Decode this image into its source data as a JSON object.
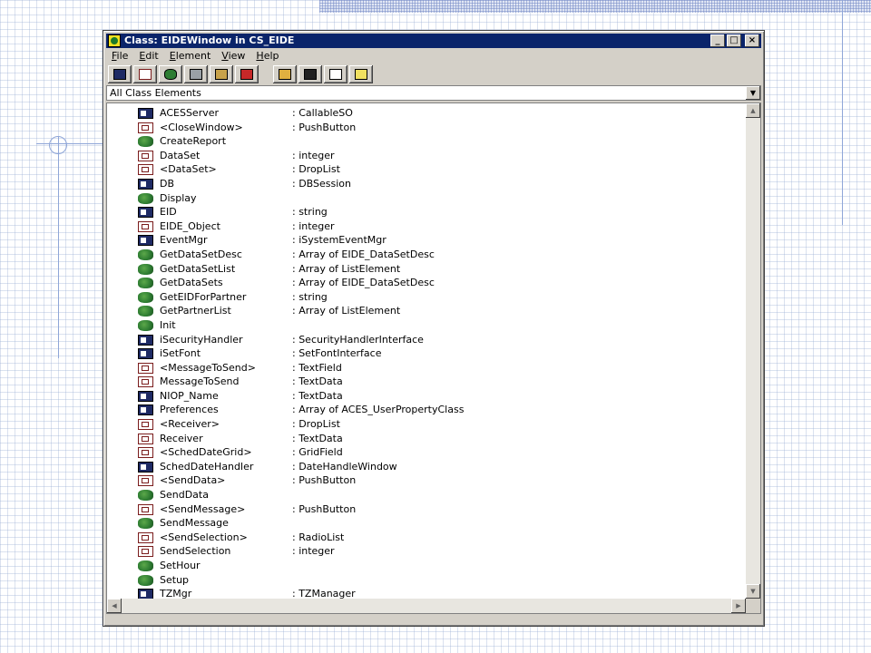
{
  "window": {
    "title": "Class: EIDEWindow in CS_EIDE",
    "controls": {
      "minimize": "_",
      "maximize": "□",
      "close": "×"
    }
  },
  "menu": [
    {
      "underline": "F",
      "rest": "ile"
    },
    {
      "underline": "E",
      "rest": "dit"
    },
    {
      "underline": "E",
      "rest": "lement"
    },
    {
      "underline": "V",
      "rest": "iew"
    },
    {
      "underline": "H",
      "rest": "elp"
    }
  ],
  "toolbar": [
    "new-attribute-icon",
    "new-widget-icon",
    "new-method-icon",
    "new-event-icon",
    "new-handler-icon",
    "new-constant-icon",
    "open-icon",
    "save-icon",
    "properties-icon",
    "help-icon"
  ],
  "filter": {
    "selected": "All Class Elements"
  },
  "elements": [
    {
      "kind": "attr",
      "name": "ACESServer",
      "type": ": CallableSO"
    },
    {
      "kind": "widget",
      "name": "<CloseWindow>",
      "type": ": PushButton"
    },
    {
      "kind": "method",
      "name": "CreateReport",
      "type": ""
    },
    {
      "kind": "widget",
      "name": "DataSet",
      "type": ": integer"
    },
    {
      "kind": "widget",
      "name": "<DataSet>",
      "type": ": DropList"
    },
    {
      "kind": "attr",
      "name": "DB",
      "type": ": DBSession"
    },
    {
      "kind": "method",
      "name": "Display",
      "type": ""
    },
    {
      "kind": "attr",
      "name": "EID",
      "type": ": string"
    },
    {
      "kind": "widget",
      "name": "EIDE_Object",
      "type": ": integer"
    },
    {
      "kind": "attr",
      "name": "EventMgr",
      "type": ": iSystemEventMgr"
    },
    {
      "kind": "method",
      "name": "GetDataSetDesc",
      "type": ": Array of EIDE_DataSetDesc"
    },
    {
      "kind": "method",
      "name": "GetDataSetList",
      "type": ": Array of ListElement"
    },
    {
      "kind": "method",
      "name": "GetDataSets",
      "type": ": Array of EIDE_DataSetDesc"
    },
    {
      "kind": "method",
      "name": "GetEIDForPartner",
      "type": ": string"
    },
    {
      "kind": "method",
      "name": "GetPartnerList",
      "type": ": Array of ListElement"
    },
    {
      "kind": "method",
      "name": "Init",
      "type": ""
    },
    {
      "kind": "attr",
      "name": "iSecurityHandler",
      "type": ": SecurityHandlerInterface"
    },
    {
      "kind": "attr",
      "name": "iSetFont",
      "type": ": SetFontInterface"
    },
    {
      "kind": "widget",
      "name": "<MessageToSend>",
      "type": ": TextField"
    },
    {
      "kind": "widget",
      "name": "MessageToSend",
      "type": ": TextData"
    },
    {
      "kind": "attr",
      "name": "NIOP_Name",
      "type": ": TextData"
    },
    {
      "kind": "attr",
      "name": "Preferences",
      "type": ": Array of ACES_UserPropertyClass"
    },
    {
      "kind": "widget",
      "name": "<Receiver>",
      "type": ": DropList"
    },
    {
      "kind": "widget",
      "name": "Receiver",
      "type": ": TextData"
    },
    {
      "kind": "widget",
      "name": "<SchedDateGrid>",
      "type": ": GridField"
    },
    {
      "kind": "attr",
      "name": "SchedDateHandler",
      "type": ": DateHandleWindow"
    },
    {
      "kind": "widget",
      "name": "<SendData>",
      "type": ": PushButton"
    },
    {
      "kind": "method",
      "name": "SendData",
      "type": ""
    },
    {
      "kind": "widget",
      "name": "<SendMessage>",
      "type": ": PushButton"
    },
    {
      "kind": "method",
      "name": "SendMessage",
      "type": ""
    },
    {
      "kind": "widget",
      "name": "<SendSelection>",
      "type": ": RadioList"
    },
    {
      "kind": "widget",
      "name": "SendSelection",
      "type": ": integer"
    },
    {
      "kind": "method",
      "name": "SetHour",
      "type": ""
    },
    {
      "kind": "method",
      "name": "Setup",
      "type": ""
    },
    {
      "kind": "attr",
      "name": "TZMgr",
      "type": ": TZManager"
    }
  ]
}
